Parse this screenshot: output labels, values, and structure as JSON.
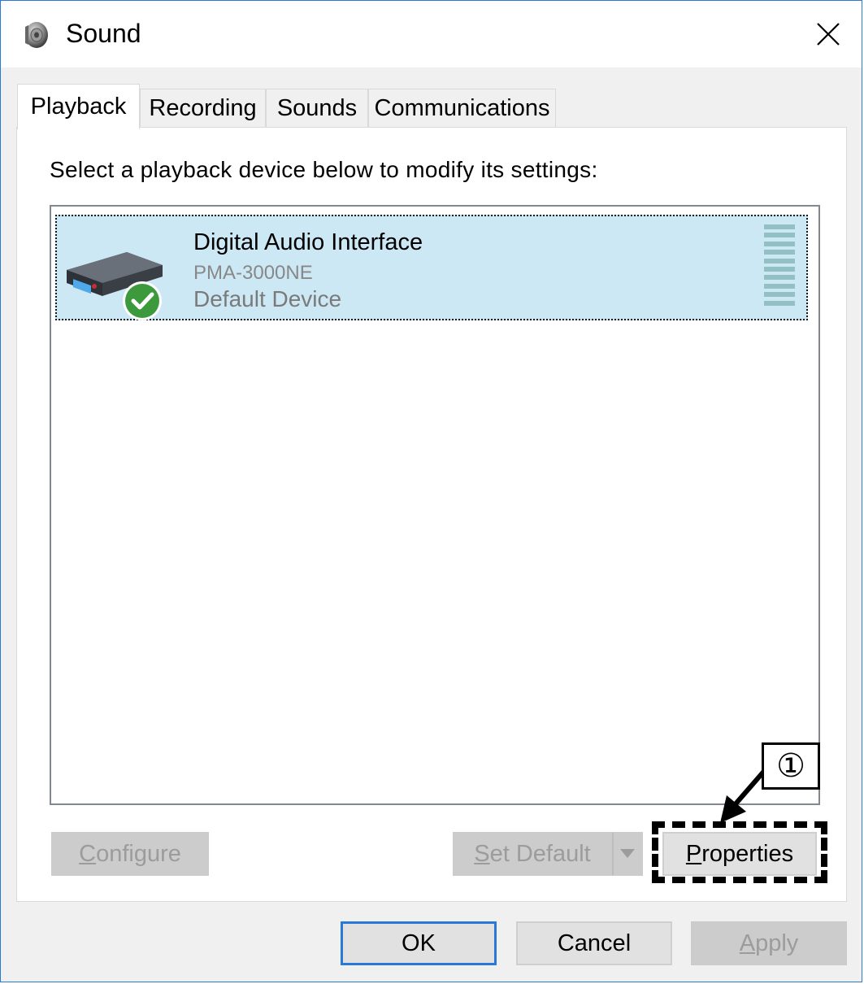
{
  "window": {
    "title": "Sound",
    "accent_color": "#2b79d6",
    "title_icon": "speaker-icon",
    "close_icon": "close-icon"
  },
  "tabs": [
    {
      "label": "Playback",
      "active": true
    },
    {
      "label": "Recording",
      "active": false
    },
    {
      "label": "Sounds",
      "active": false
    },
    {
      "label": "Communications",
      "active": false
    }
  ],
  "playback": {
    "instruction": "Select a playback device below to modify its settings:",
    "devices": [
      {
        "name": "Digital Audio Interface",
        "model": "PMA-3000NE",
        "status": "Default Device",
        "selected": true,
        "icon": "audio-device-icon",
        "badge_icon": "default-check-icon",
        "selection_color": "#cce8f4"
      }
    ]
  },
  "panel_buttons": {
    "configure": {
      "label_accel": "C",
      "label_rest": "onfigure",
      "enabled": false
    },
    "set_default": {
      "label_accel": "S",
      "label_rest": "et Default",
      "enabled": false
    },
    "properties": {
      "label_accel": "P",
      "label_rest": "roperties",
      "enabled": true
    }
  },
  "dialog_buttons": {
    "ok": {
      "label": "OK",
      "default": true
    },
    "cancel": {
      "label": "Cancel"
    },
    "apply": {
      "label_accel": "A",
      "label_rest": "pply",
      "enabled": false
    }
  },
  "annotation": {
    "marker": "①",
    "target": "properties-button"
  }
}
